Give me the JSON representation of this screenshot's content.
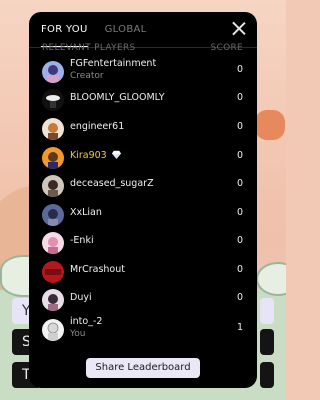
{
  "tabs": [
    {
      "label": "FOR YOU",
      "active": true
    },
    {
      "label": "GLOBAL",
      "active": false
    }
  ],
  "headers": {
    "players": "RELEVANT PLAYERS",
    "score": "SCORE"
  },
  "players": [
    {
      "name": "FGFentertainment",
      "subtitle": "Creator",
      "score": "0"
    },
    {
      "name": "BLOOMLY_GLOOMLY",
      "score": "0"
    },
    {
      "name": "engineer61",
      "score": "0"
    },
    {
      "name": "Kira903",
      "score": "0",
      "badge": "diamond-icon"
    },
    {
      "name": "deceased_sugarZ",
      "score": "0"
    },
    {
      "name": "XxLian",
      "score": "0"
    },
    {
      "name": "-Enki",
      "score": "0"
    },
    {
      "name": "MrCrashout",
      "score": "0"
    },
    {
      "name": "Duyi",
      "score": "0"
    },
    {
      "name": "into_-2",
      "subtitle": "You",
      "score": "1"
    }
  ],
  "share_button": "Share Leaderboard",
  "background_buttons": [
    "Y",
    "S",
    "T"
  ],
  "colors": {
    "panel": "#000000",
    "highlight_name": "#f4c54a",
    "button": "#eae7f6"
  }
}
